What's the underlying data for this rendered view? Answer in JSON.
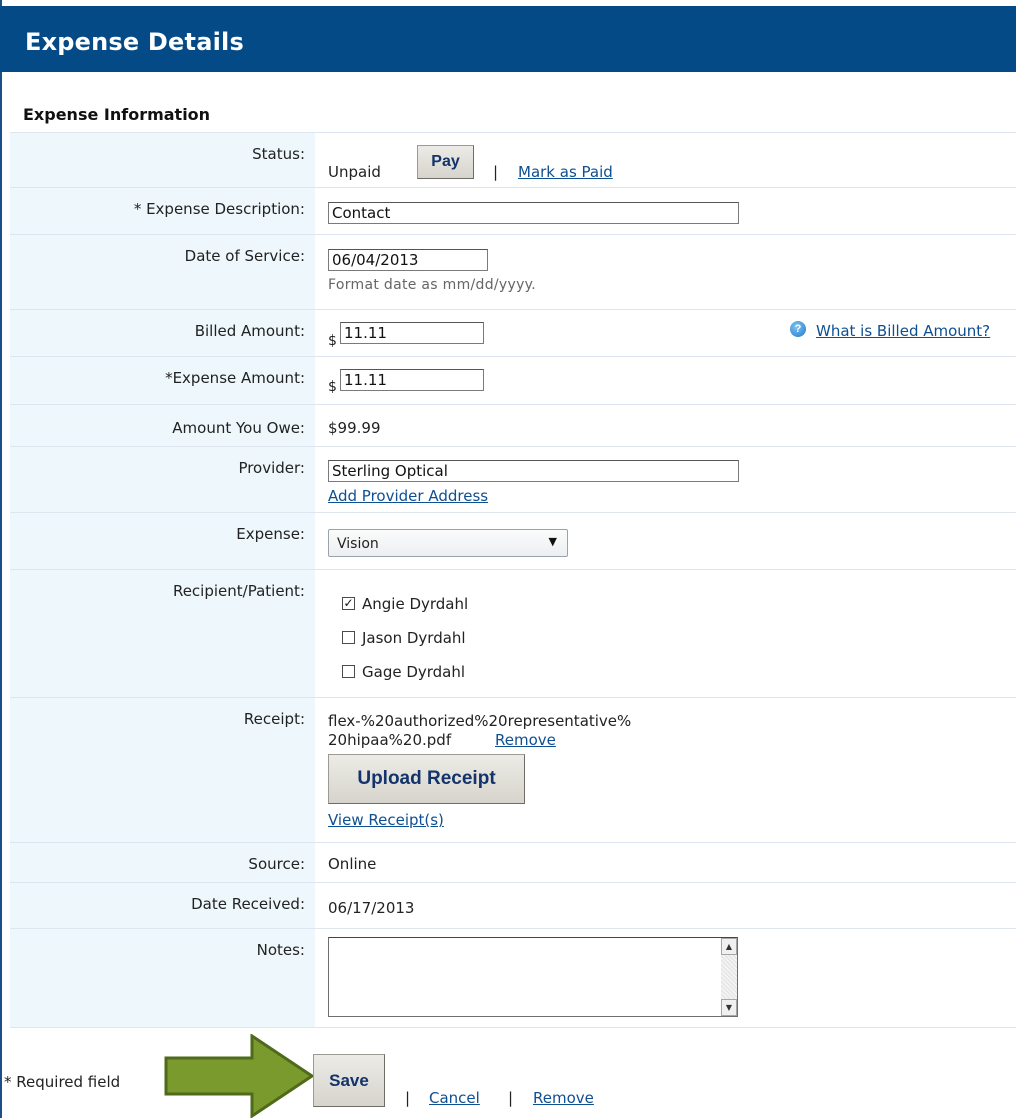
{
  "header": {
    "title": "Expense Details"
  },
  "section": {
    "title": "Expense Information"
  },
  "status": {
    "label": "Status:",
    "value": "Unpaid",
    "pay_button": "Pay",
    "separator": "|",
    "mark_paid_link": "Mark as Paid"
  },
  "description": {
    "label": "* Expense Description:",
    "value": "Contact"
  },
  "date_of_service": {
    "label": "Date of Service:",
    "value": "06/04/2013",
    "hint": "Format date as mm/dd/yyyy."
  },
  "billed_amount": {
    "label": "Billed Amount:",
    "currency": "$",
    "value": "11.11",
    "help_icon": "question-icon",
    "help_link": "What is Billed Amount?"
  },
  "expense_amount": {
    "label": "*Expense Amount:",
    "currency": "$",
    "value": "11.11"
  },
  "amount_owed": {
    "label": "Amount You Owe:",
    "value": "$99.99"
  },
  "provider": {
    "label": "Provider:",
    "value": "Sterling Optical",
    "add_address_link": "Add Provider Address"
  },
  "expense_type": {
    "label": "Expense:",
    "selected": "Vision"
  },
  "recipients": {
    "label": "Recipient/Patient:",
    "options": [
      {
        "name": "Angie Dyrdahl",
        "checked": true
      },
      {
        "name": "Jason Dyrdahl",
        "checked": false
      },
      {
        "name": "Gage Dyrdahl",
        "checked": false
      }
    ]
  },
  "receipt": {
    "label": "Receipt:",
    "filename_line1": "flex-%20authorized%20representative%",
    "filename_line2": "20hipaa%20.pdf",
    "remove_link": "Remove",
    "upload_button": "Upload Receipt",
    "view_link": "View Receipt(s)"
  },
  "source": {
    "label": "Source:",
    "value": "Online"
  },
  "date_received": {
    "label": "Date Received:",
    "value": "06/17/2013"
  },
  "notes": {
    "label": "Notes:",
    "value": ""
  },
  "footer": {
    "required_note": "* Required field",
    "save_button": "Save",
    "separator": "|",
    "cancel_link": "Cancel",
    "remove_link": "Remove",
    "arrow_color": "#7a9a2e"
  },
  "colors": {
    "header_bg": "#044a86",
    "label_bg": "#eef8fc",
    "link": "#0e4f92"
  }
}
